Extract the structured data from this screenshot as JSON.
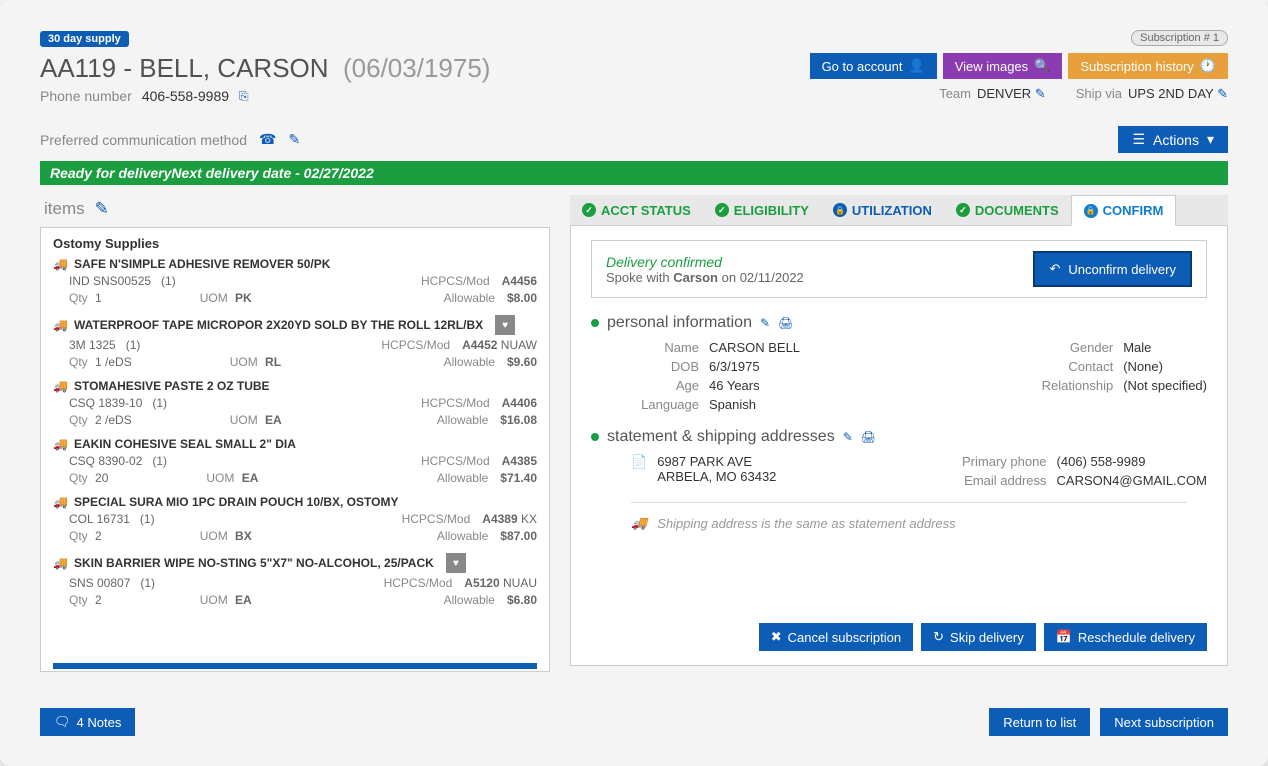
{
  "header": {
    "supply_badge": "30 day supply",
    "sub_badge": "Subscription #  1",
    "patient_id": "AA119",
    "patient_name": "BELL, CARSON",
    "dob": "(06/03/1975)",
    "phone_label": "Phone number",
    "phone": "406-558-9989",
    "go_account": "Go to account",
    "view_images": "View images",
    "sub_history": "Subscription history",
    "team_label": "Team",
    "team": "DENVER",
    "ship_label": "Ship via",
    "ship": "UPS 2ND DAY",
    "pref_label": "Preferred communication method",
    "actions": "Actions"
  },
  "status": {
    "left": "Ready for delivery",
    "right": "Next delivery date - 02/27/2022"
  },
  "items": {
    "title": "items",
    "category": "Ostomy Supplies",
    "list": [
      {
        "name": "SAFE N'SIMPLE ADHESIVE REMOVER 50/PK",
        "code": "IND SNS00525",
        "mult": "(1)",
        "qty": "1",
        "eds": "",
        "uom": "PK",
        "hcpcs": "A4456",
        "mod": "",
        "allow": "$8.00",
        "fav": false
      },
      {
        "name": "WATERPROOF TAPE MICROPOR 2X20YD SOLD BY THE ROLL  12RL/BX",
        "code": "3M 1325",
        "mult": "(1)",
        "qty": "1",
        "eds": "/eDS",
        "uom": "RL",
        "hcpcs": "A4452",
        "mod": "NUAW",
        "allow": "$9.60",
        "fav": true
      },
      {
        "name": "STOMAHESIVE PASTE 2 OZ TUBE",
        "code": "CSQ 1839-10",
        "mult": "(1)",
        "qty": "2",
        "eds": "/eDS",
        "uom": "EA",
        "hcpcs": "A4406",
        "mod": "",
        "allow": "$16.08",
        "fav": false
      },
      {
        "name": "EAKIN COHESIVE SEAL SMALL 2\" DIA",
        "code": "CSQ 8390-02",
        "mult": "(1)",
        "qty": "20",
        "eds": "",
        "uom": "EA",
        "hcpcs": "A4385",
        "mod": "",
        "allow": "$71.40",
        "fav": false
      },
      {
        "name": "SPECIAL SURA MIO 1PC DRAIN POUCH 10/BX, OSTOMY",
        "code": "COL 16731",
        "mult": "(1)",
        "qty": "2",
        "eds": "",
        "uom": "BX",
        "hcpcs": "A4389",
        "mod": "KX",
        "allow": "$87.00",
        "fav": false
      },
      {
        "name": "SKIN BARRIER WIPE NO-STING 5\"X7\" NO-ALCOHOL, 25/PACK",
        "code": "SNS 00807",
        "mult": "(1)",
        "qty": "2",
        "eds": "",
        "uom": "EA",
        "hcpcs": "A5120",
        "mod": "NUAU",
        "allow": "$6.80",
        "fav": true
      }
    ],
    "labels": {
      "qty": "Qty",
      "uom": "UOM",
      "hcpcs": "HCPCS/Mod",
      "allow": "Allowable"
    }
  },
  "tabs": {
    "acct": "ACCT STATUS",
    "elig": "ELIGIBILITY",
    "util": "UTILIZATION",
    "docs": "DOCUMENTS",
    "conf": "CONFIRM"
  },
  "confirm": {
    "msg1": "Delivery confirmed",
    "msg2_pre": "Spoke with ",
    "msg2_name": "Carson",
    "msg2_mid": " on ",
    "msg2_date": "02/11/2022",
    "btn": "Unconfirm delivery"
  },
  "personal": {
    "title": "personal information",
    "name_k": "Name",
    "name_v": "CARSON BELL",
    "dob_k": "DOB",
    "dob_v": "6/3/1975",
    "age_k": "Age",
    "age_v": "46 Years",
    "lang_k": "Language",
    "lang_v": "Spanish",
    "gender_k": "Gender",
    "gender_v": "Male",
    "contact_k": "Contact",
    "contact_v": "(None)",
    "rel_k": "Relationship",
    "rel_v": "(Not specified)"
  },
  "address": {
    "title": "statement & shipping addresses",
    "line1": "6987 PARK AVE",
    "line2": "ARBELA, MO 63432",
    "phone_k": "Primary phone",
    "phone_v": "(406) 558-9989",
    "email_k": "Email address",
    "email_v": "CARSON4@GMAIL.COM",
    "ship_note": "Shipping address is the same as statement address"
  },
  "actions": {
    "cancel": "Cancel subscription",
    "skip": "Skip delivery",
    "resched": "Reschedule delivery"
  },
  "footer": {
    "notes": "4 Notes",
    "return": "Return to list",
    "next": "Next subscription"
  }
}
